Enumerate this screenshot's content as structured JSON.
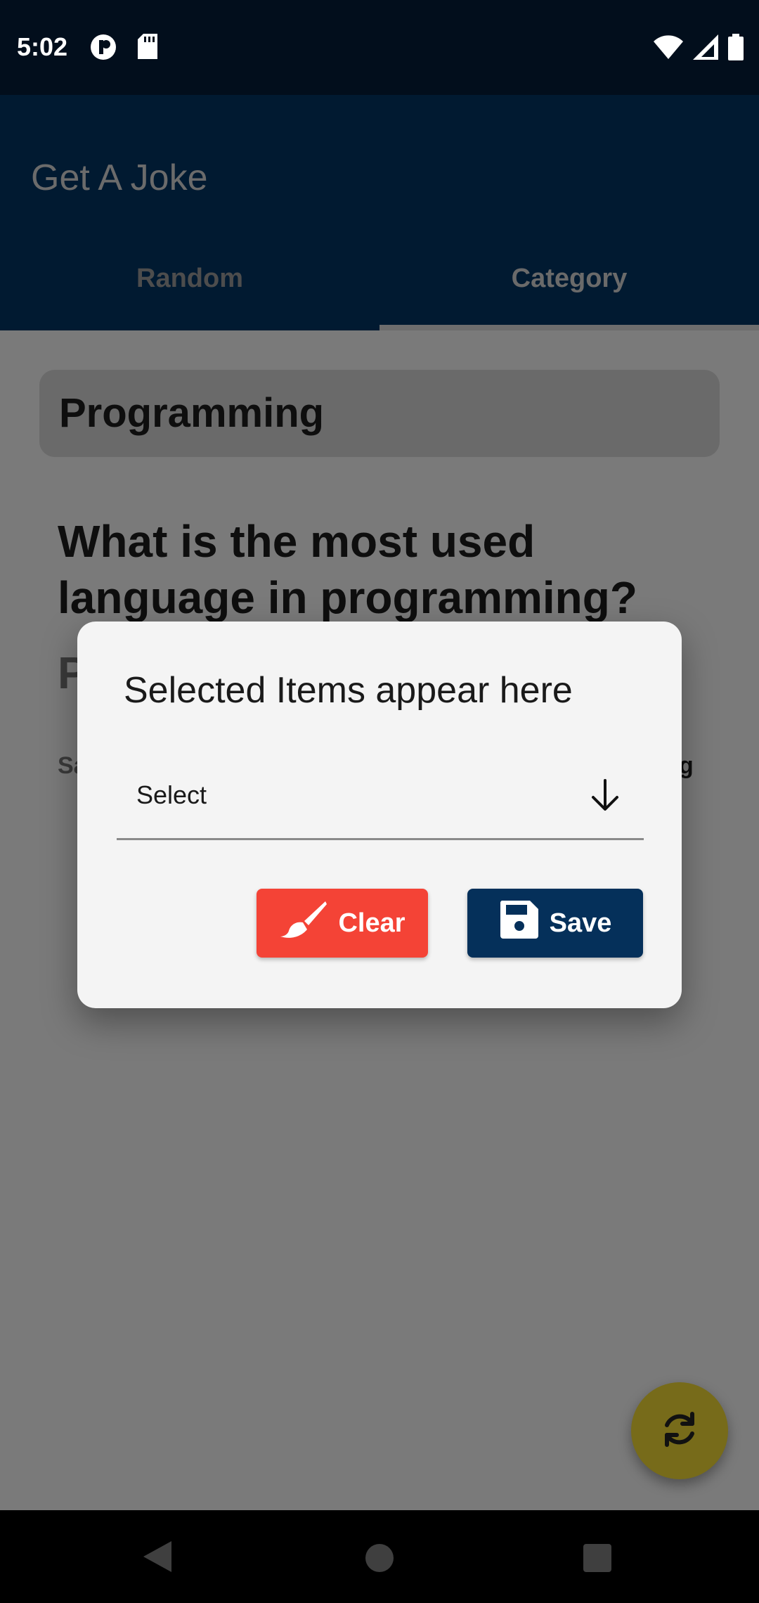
{
  "status_bar": {
    "time": "5:02"
  },
  "app_bar": {
    "title": "Get A Joke",
    "tabs": [
      {
        "label": "Random",
        "selected": false
      },
      {
        "label": "Category",
        "selected": true
      }
    ]
  },
  "content": {
    "category": "Programming",
    "joke_question": "What is the most used language in programming?",
    "joke_answer_peek": "P",
    "meta_left": "Sa",
    "meta_right": "g"
  },
  "dialog": {
    "title": "Selected Items appear here",
    "select_placeholder": "Select",
    "clear_label": "Clear",
    "save_label": "Save"
  },
  "colors": {
    "clear_button": "#f44336",
    "save_button": "#05305a",
    "app_bar": "#011a31",
    "fab": "#776b1a"
  },
  "icons": {
    "clear": "brush-icon",
    "save": "floppy-disk-icon",
    "select": "arrow-down-icon",
    "fab": "refresh-icon"
  }
}
